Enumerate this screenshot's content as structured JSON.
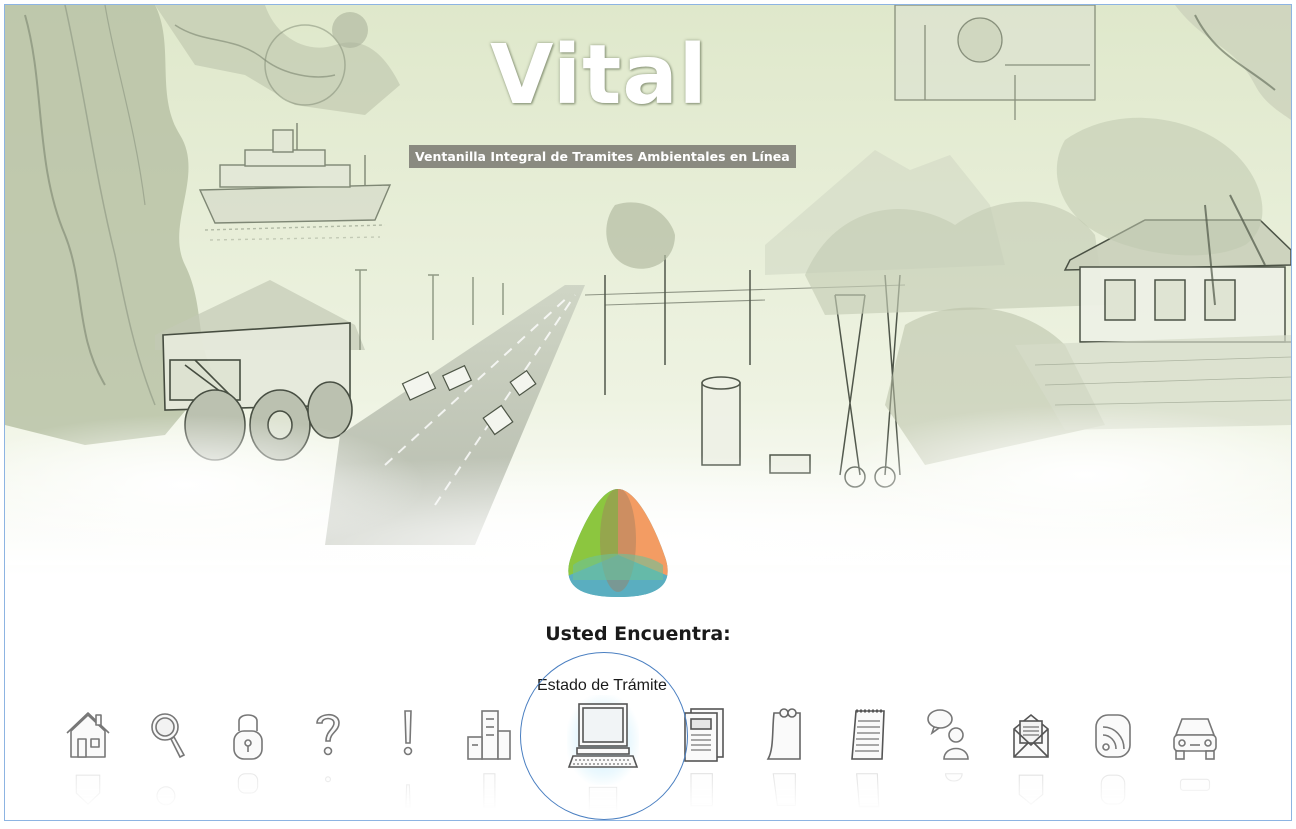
{
  "brand": {
    "title": "Vital",
    "subtitle": "Ventanilla Integral de Tramites Ambientales en Línea"
  },
  "section": {
    "heading": "Usted Encuentra:"
  },
  "toolbar": {
    "hover_label": "Estado de Trámite",
    "active_index": 6,
    "items": [
      {
        "icon": "house-icon"
      },
      {
        "icon": "magnifier-icon"
      },
      {
        "icon": "padlock-icon"
      },
      {
        "icon": "question-mark-icon"
      },
      {
        "icon": "exclamation-icon"
      },
      {
        "icon": "buildings-icon"
      },
      {
        "icon": "computer-icon"
      },
      {
        "icon": "document-icon"
      },
      {
        "icon": "note-paper-icon"
      },
      {
        "icon": "notepad-icon"
      },
      {
        "icon": "person-chat-icon"
      },
      {
        "icon": "envelope-icon"
      },
      {
        "icon": "rss-icon"
      },
      {
        "icon": "car-icon"
      }
    ]
  },
  "colors": {
    "frame_border": "#8db4e2",
    "highlight_circle": "#4a7fc1",
    "logo_green": "#8cc63f",
    "logo_orange": "#f39c63",
    "logo_teal": "#5aaec0"
  }
}
